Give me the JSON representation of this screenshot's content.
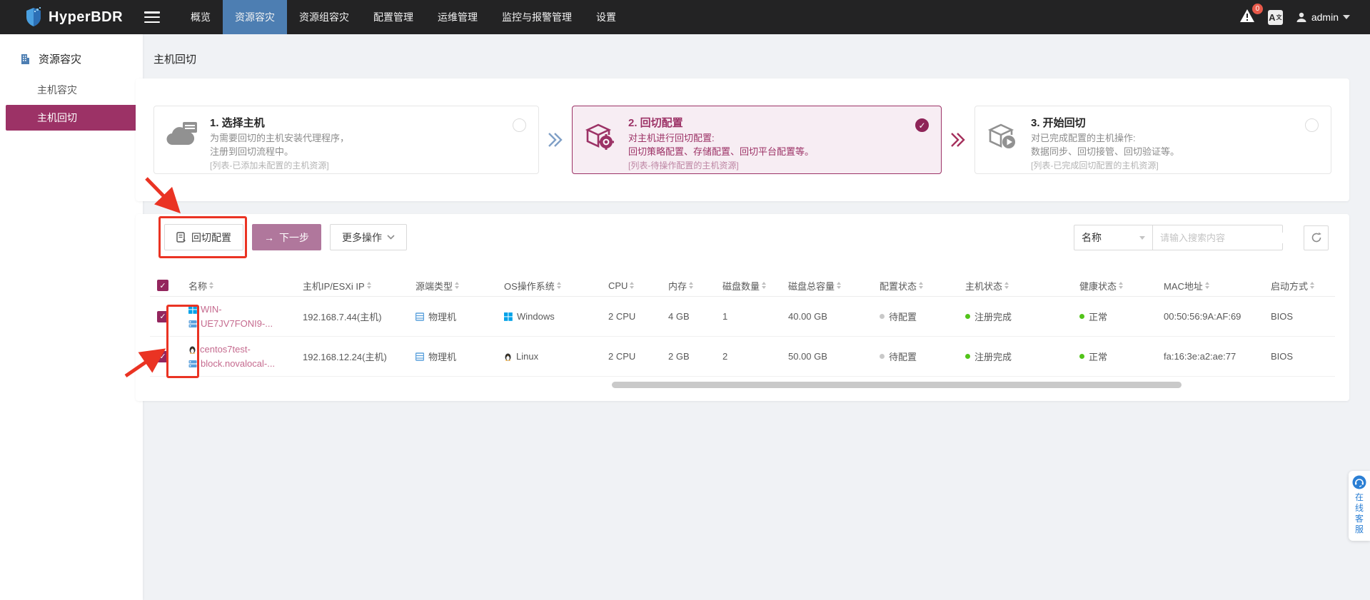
{
  "colors": {
    "accent": "#9c3266",
    "nav_active": "#4d7eb2",
    "link": "#c56a8e",
    "status_green": "#52c41a",
    "annotation_red": "#ea3323",
    "next_button": "#b0779c"
  },
  "navbar": {
    "brand": "HyperBDR",
    "items": [
      "概览",
      "资源容灾",
      "资源组容灾",
      "配置管理",
      "运维管理",
      "监控与报警管理",
      "设置"
    ],
    "badge_count": "0",
    "user": "admin"
  },
  "sidebar": {
    "section": "资源容灾",
    "items": [
      {
        "label": "主机容灾"
      },
      {
        "label": "主机回切"
      }
    ]
  },
  "page": {
    "title": "主机回切"
  },
  "steps": [
    {
      "title": "1. 选择主机",
      "line1": "为需要回切的主机安装代理程序，",
      "line2": "注册到回切流程中。",
      "note": "[列表-已添加未配置的主机资源]"
    },
    {
      "title": "2. 回切配置",
      "line1": "对主机进行回切配置:",
      "line2": "回切策略配置、存储配置、回切平台配置等。",
      "note": "[列表-待操作配置的主机资源]",
      "check": "✓"
    },
    {
      "title": "3. 开始回切",
      "line1": "对已完成配置的主机操作:",
      "line2": "数据同步、回切接管、回切验证等。",
      "note": "[列表-已完成回切配置的主机资源]"
    }
  ],
  "toolbar": {
    "failback_config": "回切配置",
    "next_step": "下一步",
    "next_arrow": "→",
    "more_actions": "更多操作",
    "filter_field": "名称",
    "search_placeholder": "请输入搜索内容"
  },
  "table": {
    "columns": [
      "名称",
      "主机IP/ESXi IP",
      "源端类型",
      "OS操作系统",
      "CPU",
      "内存",
      "磁盘数量",
      "磁盘总容量",
      "配置状态",
      "主机状态",
      "健康状态",
      "MAC地址",
      "启动方式"
    ],
    "rows": [
      {
        "name_line1": "WIN-",
        "name_line2": "UE7JV7FONI9-...",
        "ip": "192.168.7.44(主机)",
        "source_type": "物理机",
        "os": "Windows",
        "cpu": "2 CPU",
        "memory": "4 GB",
        "disk_count": "1",
        "disk_total": "40.00 GB",
        "config_status": "待配置",
        "host_status": "注册完成",
        "health_status": "正常",
        "mac": "00:50:56:9A:AF:69",
        "boot_mode": "BIOS"
      },
      {
        "name_line1": "centos7test-",
        "name_line2": "block.novalocal-...",
        "ip": "192.168.12.24(主机)",
        "source_type": "物理机",
        "os": "Linux",
        "cpu": "2 CPU",
        "memory": "2 GB",
        "disk_count": "2",
        "disk_total": "50.00 GB",
        "config_status": "待配置",
        "host_status": "注册完成",
        "health_status": "正常",
        "mac": "fa:16:3e:a2:ae:77",
        "boot_mode": "BIOS"
      }
    ]
  },
  "service_widget": {
    "label": "在线客服"
  },
  "check_glyph": "✓"
}
